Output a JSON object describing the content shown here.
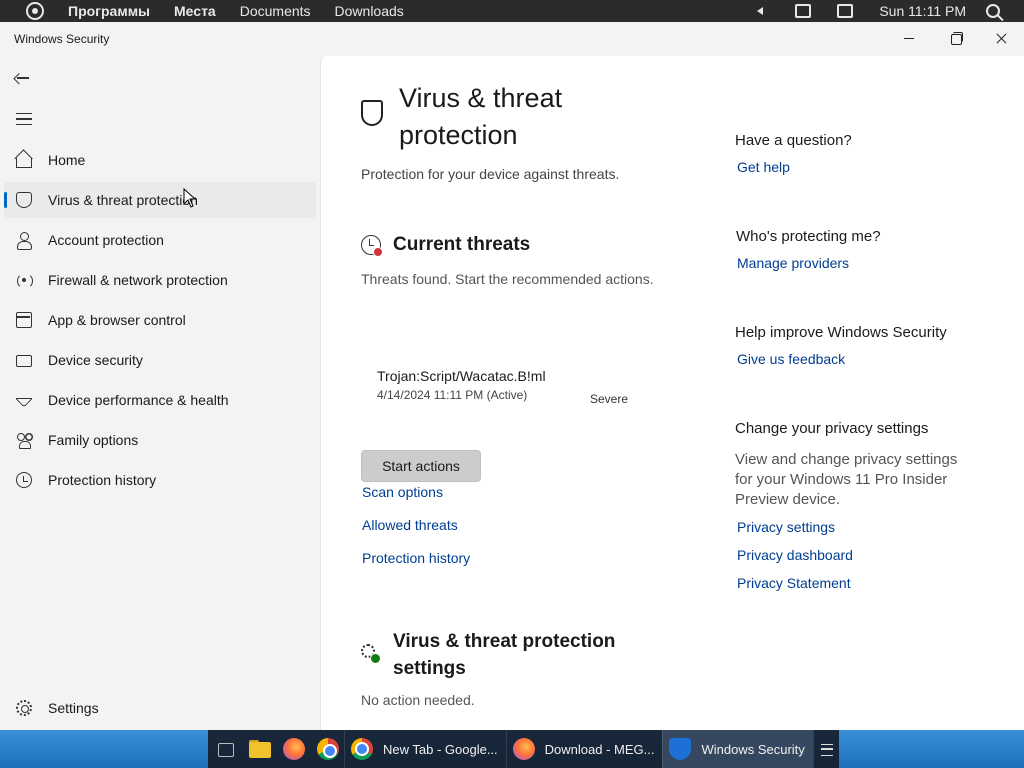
{
  "top_panel": {
    "menu_items": [
      "Программы",
      "Места",
      "Documents",
      "Downloads"
    ],
    "clock": "Sun 11:11 PM"
  },
  "window": {
    "title": "Windows Security"
  },
  "sidebar": {
    "items": [
      {
        "label": "Home",
        "icon": "home-icon"
      },
      {
        "label": "Virus & threat protection",
        "icon": "shield-icon",
        "active": true
      },
      {
        "label": "Account protection",
        "icon": "person-icon"
      },
      {
        "label": "Firewall & network protection",
        "icon": "wifi-icon"
      },
      {
        "label": "App & browser control",
        "icon": "browser-icon"
      },
      {
        "label": "Device security",
        "icon": "device-icon"
      },
      {
        "label": "Device performance & health",
        "icon": "heart-icon"
      },
      {
        "label": "Family options",
        "icon": "family-icon"
      },
      {
        "label": "Protection history",
        "icon": "history-icon"
      }
    ],
    "settings_label": "Settings"
  },
  "main": {
    "title": "Virus & threat protection",
    "subtitle": "Protection for your device against threats.",
    "current_threats": {
      "title": "Current threats",
      "subtitle": "Threats found. Start the recommended actions.",
      "threat": {
        "name": "Trojan:Script/Wacatac.B!ml",
        "date": "4/14/2024 11:11 PM (Active)",
        "severity": "Severe"
      },
      "start_button": "Start actions",
      "links": [
        "Scan options",
        "Allowed threats",
        "Protection history"
      ]
    },
    "settings_section": {
      "title": "Virus & threat protection settings",
      "subtitle": "No action needed."
    }
  },
  "right_panel": {
    "question": {
      "heading": "Have a question?",
      "link": "Get help"
    },
    "protecting": {
      "heading": "Who's protecting me?",
      "link": "Manage providers"
    },
    "improve": {
      "heading": "Help improve Windows Security",
      "link": "Give us feedback"
    },
    "privacy": {
      "heading": "Change your privacy settings",
      "text": "View and change privacy settings for your Windows 11 Pro Insider Preview device.",
      "links": [
        "Privacy settings",
        "Privacy dashboard",
        "Privacy Statement"
      ]
    }
  },
  "taskbar": {
    "tasks": [
      {
        "label": "New Tab - Google...",
        "icon": "chrome-icon"
      },
      {
        "label": "Download - MEG...",
        "icon": "firefox-icon"
      },
      {
        "label": "Windows Security",
        "icon": "windows-security-icon",
        "active": true
      }
    ]
  },
  "colors": {
    "accent": "#0067c0",
    "link": "#003e92",
    "threat_badge": "#d13438",
    "ok_badge": "#107c10"
  }
}
